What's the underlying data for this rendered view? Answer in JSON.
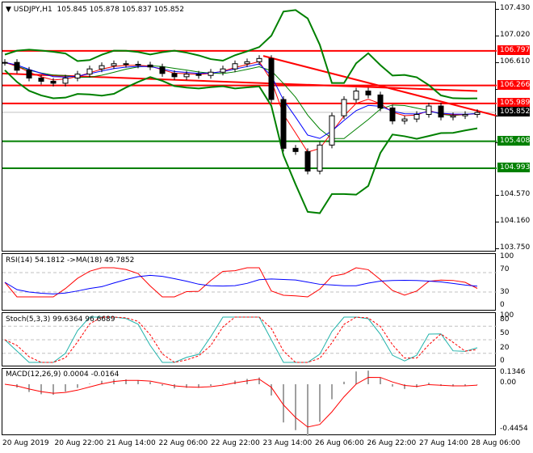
{
  "header": {
    "arrow": "▼",
    "symbol": "USDJPY,H1",
    "ohlc": "105.845 105.878 105.837 105.852"
  },
  "price_axis": [
    "107.430",
    "107.020",
    "106.610",
    "106.200",
    "105.790",
    "105.380",
    "104.570",
    "104.160",
    "103.750"
  ],
  "levels": [
    {
      "label": "106.797",
      "price": 106.797,
      "color": "#ff0000"
    },
    {
      "label": "106.266",
      "price": 106.266,
      "color": "#ff0000"
    },
    {
      "label": "105.989",
      "price": 105.989,
      "color": "#ff0000"
    },
    {
      "label": "105.852",
      "price": 105.852,
      "color": "#000000"
    },
    {
      "label": "105.408",
      "price": 105.408,
      "color": "#008000"
    },
    {
      "label": "104.993",
      "price": 104.993,
      "color": "#008000"
    }
  ],
  "rsi": {
    "label": "RSI(14) 54.1812  ->MA(18) 49.7852",
    "axis": [
      "100",
      "70",
      "30",
      "0"
    ]
  },
  "stoch": {
    "label": "Stoch(5,3,3) 99.6364 96.6689",
    "axis": [
      "100",
      "80",
      "50",
      "20",
      "0"
    ]
  },
  "macd": {
    "label": "MACD(12,26,9) 0.0004 -0.0164",
    "axis": [
      "0.1346",
      "0.00",
      "-0.4454"
    ]
  },
  "time_axis": [
    "20 Aug 2019",
    "20 Aug 22:00",
    "21 Aug 14:00",
    "22 Aug 06:00",
    "22 Aug 22:00",
    "23 Aug 14:00",
    "26 Aug 06:00",
    "26 Aug 22:00",
    "27 Aug 14:00",
    "28 Aug 06:00"
  ],
  "chart_data": {
    "type": "line",
    "title": "USDJPY,H1",
    "ylim": [
      103.75,
      107.43
    ],
    "closes": [
      106.62,
      106.5,
      106.38,
      106.33,
      106.3,
      106.38,
      106.44,
      106.52,
      106.57,
      106.6,
      106.59,
      106.58,
      106.55,
      106.45,
      106.4,
      106.44,
      106.42,
      106.47,
      106.52,
      106.6,
      106.63,
      106.68,
      106.05,
      105.3,
      105.25,
      104.95,
      105.35,
      105.8,
      106.05,
      106.18,
      106.12,
      105.92,
      105.72,
      105.75,
      105.82,
      105.95,
      105.78,
      105.8,
      105.82,
      105.85
    ],
    "colors": {
      "up": "#000000",
      "bands": "#008000",
      "ma_fast": "#ff0000",
      "ma_slow": "#0000ff",
      "signal": "#ff0000",
      "stoch_main": "#20b2aa"
    }
  }
}
